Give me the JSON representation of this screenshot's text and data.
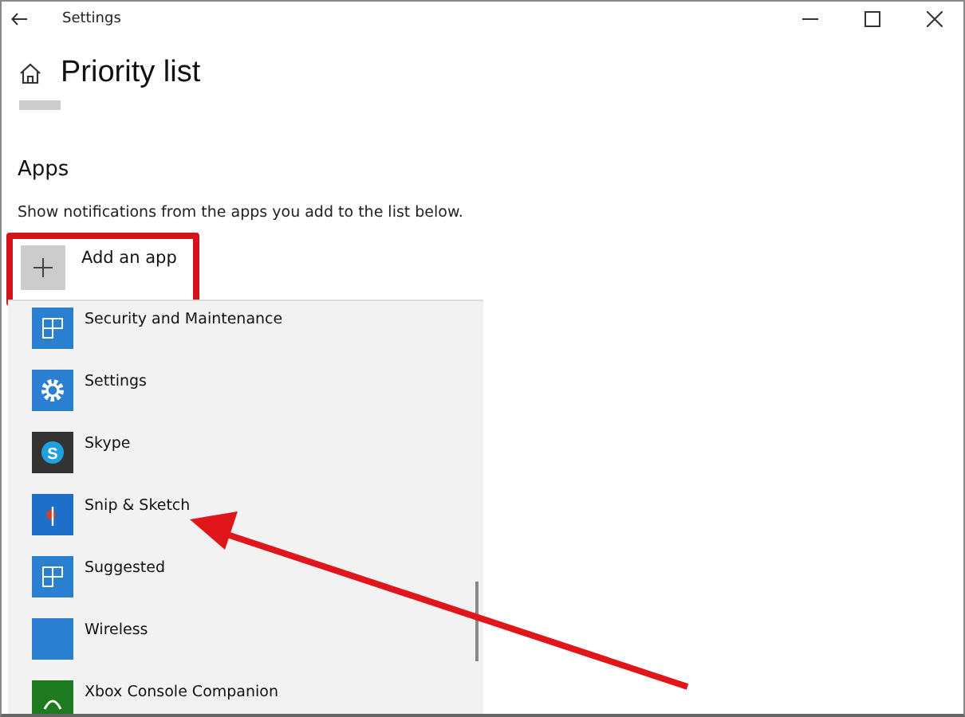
{
  "window": {
    "title": "Settings"
  },
  "page": {
    "title": "Priority list"
  },
  "section": {
    "title": "Apps",
    "description": "Show notifications from the apps you add to the list below."
  },
  "add_button": {
    "label": "Add an app",
    "highlighted": true
  },
  "app_list": [
    {
      "name": "Security and Maintenance",
      "kind": "tiles"
    },
    {
      "name": "Settings",
      "kind": "gear"
    },
    {
      "name": "Skype",
      "kind": "skype",
      "icon_letter": "S"
    },
    {
      "name": "Snip & Sketch",
      "kind": "snip"
    },
    {
      "name": "Suggested",
      "kind": "tiles"
    },
    {
      "name": "Wireless",
      "kind": "plain"
    },
    {
      "name": "Xbox Console Companion",
      "kind": "xbox"
    }
  ],
  "annotation": {
    "kind": "arrow"
  }
}
